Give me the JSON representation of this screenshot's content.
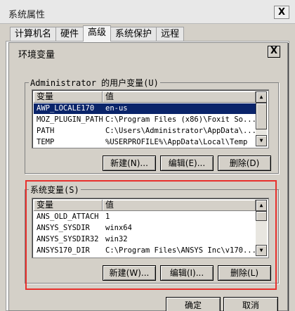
{
  "outer_window": {
    "title": "系统属性",
    "close_glyph": "X",
    "tabs": [
      {
        "label": "计算机名"
      },
      {
        "label": "硬件"
      },
      {
        "label": "高级"
      },
      {
        "label": "系统保护"
      },
      {
        "label": "远程"
      }
    ],
    "active_tab": "高级",
    "ok_label": "确定",
    "cancel_label": "取消"
  },
  "dialog": {
    "title": "环境变量",
    "close_glyph": "X",
    "user_vars": {
      "group_label": "Administrator 的用户变量(U)",
      "col_var": "变量",
      "col_val": "值",
      "rows": [
        {
          "name": "AWP_LOCALE170",
          "value": "en-us",
          "selected": true
        },
        {
          "name": "MOZ_PLUGIN_PATH",
          "value": "C:\\Program Files (x86)\\Foxit So..."
        },
        {
          "name": "PATH",
          "value": "C:\\Users\\Administrator\\AppData\\..."
        },
        {
          "name": "TEMP",
          "value": "%USERPROFILE%\\AppData\\Local\\Temp"
        }
      ],
      "new_label": "新建(N)...",
      "edit_label": "编辑(E)...",
      "delete_label": "删除(D)"
    },
    "system_vars": {
      "group_label": "系统变量(S)",
      "col_var": "变量",
      "col_val": "值",
      "rows": [
        {
          "name": "ANS_OLD_ATTACH",
          "value": "1"
        },
        {
          "name": "ANSYS_SYSDIR",
          "value": "winx64"
        },
        {
          "name": "ANSYS_SYSDIR32",
          "value": "win32"
        },
        {
          "name": "ANSYS170_DIR",
          "value": "C:\\Program Files\\ANSYS Inc\\v170..."
        }
      ],
      "new_label": "新建(W)...",
      "edit_label": "编辑(I)...",
      "delete_label": "删除(L)"
    }
  },
  "colors": {
    "highlight": "#e8302c",
    "selection": "#0a246a"
  }
}
